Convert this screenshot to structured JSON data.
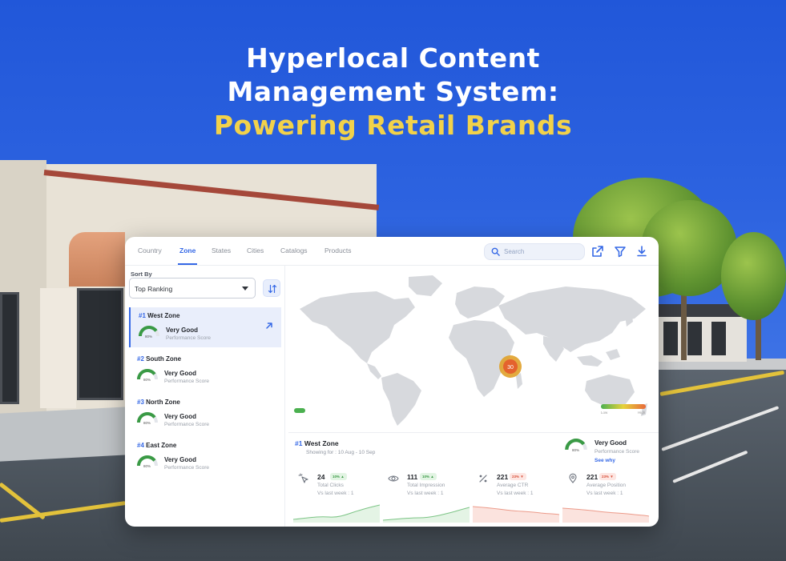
{
  "headline": {
    "line1": "Hyperlocal Content",
    "line2": "Management System:",
    "line3": "Powering Retail Brands"
  },
  "dashboard": {
    "tabs": [
      {
        "label": "Country",
        "active": false
      },
      {
        "label": "Zone",
        "active": true
      },
      {
        "label": "States",
        "active": false
      },
      {
        "label": "Cities",
        "active": false
      },
      {
        "label": "Catalogs",
        "active": false
      },
      {
        "label": "Products",
        "active": false
      }
    ],
    "search": {
      "placeholder": "Search",
      "icon": "search-icon"
    },
    "toolbar_icons": [
      "share-icon",
      "filter-icon",
      "download-icon"
    ],
    "sort": {
      "label": "Sort By",
      "selected": "Top Ranking",
      "button_icon": "sort-icon"
    },
    "zones": [
      {
        "rank": "#1",
        "name": "West Zone",
        "gauge_pct": "80%",
        "gauge_value": 0.8,
        "score": "Very Good",
        "sub": "Performance Score",
        "active": true
      },
      {
        "rank": "#2",
        "name": "South Zone",
        "gauge_pct": "80%",
        "gauge_value": 0.8,
        "score": "Very Good",
        "sub": "Performance Score",
        "active": false
      },
      {
        "rank": "#3",
        "name": "North Zone",
        "gauge_pct": "80%",
        "gauge_value": 0.8,
        "score": "Very Good",
        "sub": "Performance Score",
        "active": false
      },
      {
        "rank": "#4",
        "name": "East Zone",
        "gauge_pct": "80%",
        "gauge_value": 0.8,
        "score": "Very Good",
        "sub": "Performance Score",
        "active": false
      }
    ],
    "map": {
      "hotspot_label": "30",
      "legend_low": "Low",
      "legend_high": "High",
      "colors": {
        "low": "#4bb04f",
        "mid": "#e6d23a",
        "high": "#e86a3a"
      }
    },
    "detail": {
      "rank": "#1",
      "name": "West Zone",
      "date": "Showing for : 10 Aug - 10 Sep",
      "gauge_pct": "80%",
      "gauge_value": 0.8,
      "score": "Very Good",
      "sub": "Performance Score",
      "link": "See why"
    },
    "metrics": [
      {
        "icon": "cursor-click-icon",
        "value": "24",
        "badge": "10% ▲",
        "trend": "up",
        "label": "Total Clicks",
        "compare": "Vs last week : 1"
      },
      {
        "icon": "eye-icon",
        "value": "111",
        "badge": "10% ▲",
        "trend": "up",
        "label": "Total Impression",
        "compare": "Vs last week : 1"
      },
      {
        "icon": "percent-icon",
        "value": "221",
        "badge": "23% ▼",
        "trend": "down",
        "label": "Average CTR",
        "compare": "Vs last week : 1"
      },
      {
        "icon": "map-pin-icon",
        "value": "221",
        "badge": "23% ▼",
        "trend": "down",
        "label": "Average Position",
        "compare": "Vs last week : 1"
      }
    ],
    "accent": "#3568e6",
    "positive": "#3a9a45",
    "negative": "#d9503a"
  }
}
